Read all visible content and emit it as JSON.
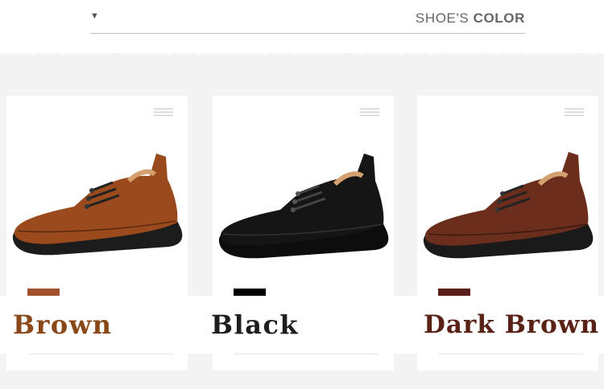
{
  "header": {
    "arrow": "▼",
    "title_light": "SHOE'S ",
    "title_bold": "COLOR"
  },
  "products": [
    {
      "label": "Brown",
      "swatch_color": "#a0522d",
      "upper_color": "#9a4a1c",
      "menu_icon": "menu-icon"
    },
    {
      "label": "Black",
      "swatch_color": "#000000",
      "upper_color": "#151515",
      "menu_icon": "menu-icon"
    },
    {
      "label": "Dark Brown",
      "swatch_color": "#5a1f1a",
      "upper_color": "#6b2d1c",
      "menu_icon": "menu-icon"
    }
  ]
}
